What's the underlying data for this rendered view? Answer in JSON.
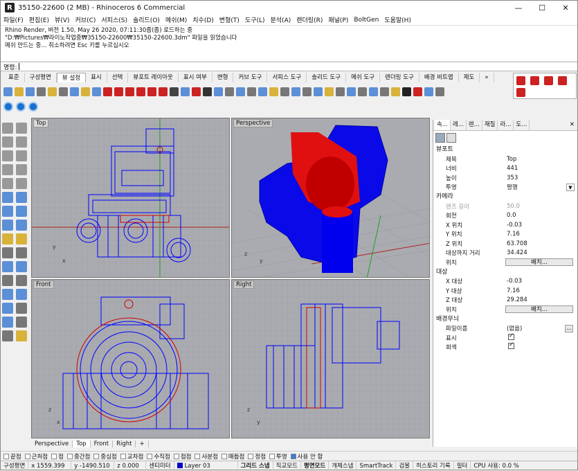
{
  "window": {
    "title": "35150-22600 (2 MB) - Rhinoceros 6 Commercial",
    "minimize": "—",
    "maximize": "☐",
    "close": "✕"
  },
  "menu": [
    "파일(F)",
    "편집(E)",
    "뷰(V)",
    "커브(C)",
    "서피스(S)",
    "솔리드(O)",
    "메쉬(M)",
    "치수(D)",
    "변형(T)",
    "도구(L)",
    "분석(A)",
    "렌더링(R)",
    "패널(P)",
    "BoltGen",
    "도움말(H)"
  ],
  "history": [
    "Rhino Render, 버전 1.50, May 26 2020, 07:11:30좀(좀) 로드하는 중",
    "\"D:₩Pictures₩라이노작업중₩35150-22600₩35150-22600.3dm\" 파일을 읽었습니다",
    "메쉬 만드는 중... 취소하려면 Esc 키를 누르십시오"
  ],
  "command": {
    "label": "명령:"
  },
  "tabs": [
    "표준",
    "구성평면",
    "뷰 설정",
    "표시",
    "선택",
    "뷰포트 레이아웃",
    "표시 여부",
    "변형",
    "커브 도구",
    "서피스 도구",
    "솔리드 도구",
    "메쉬 도구",
    "렌더링 도구",
    "배경 비트맵",
    "제도",
    "»"
  ],
  "active_tab": "뷰 설정",
  "viewports": {
    "top": "Top",
    "perspective": "Perspective",
    "front": "Front",
    "right": "Right"
  },
  "viewport_tabs": [
    "Perspective",
    "Top",
    "Front",
    "Right",
    "+"
  ],
  "panel": {
    "tabs": [
      "속...",
      "레...",
      "렌...",
      "재질",
      "라...",
      "도..."
    ],
    "section_viewport": "뷰포트",
    "title_k": "제목",
    "title_v": "Top",
    "width_k": "너비",
    "width_v": "441",
    "height_k": "높이",
    "height_v": "353",
    "proj_k": "투영",
    "proj_v": "평행",
    "section_camera": "카메라",
    "lens_k": "렌즈 길이",
    "lens_v": "50.0",
    "rot_k": "회전",
    "rot_v": "0.0",
    "x_k": "X 위치",
    "x_v": "-0.03",
    "y_k": "Y 위치",
    "y_v": "7.16",
    "z_k": "Z 위치",
    "z_v": "63.708",
    "dist_k": "대상까지 거리",
    "dist_v": "34.424",
    "pos_k": "위치",
    "place_btn": "배치...",
    "section_target": "대상",
    "tx_k": "X 대상",
    "tx_v": "-0.03",
    "ty_k": "Y 대상",
    "ty_v": "7.16",
    "tz_k": "Z 대상",
    "tz_v": "29.284",
    "tpos_k": "위치",
    "tplace_btn": "배치...",
    "section_wallpaper": "배경무늬",
    "file_k": "파일이름",
    "file_v": "(없음)",
    "file_btn": "...",
    "show_k": "표시",
    "gray_k": "회색"
  },
  "osnaps": [
    {
      "label": "끝점",
      "on": false
    },
    {
      "label": "근처점",
      "on": false
    },
    {
      "label": "점",
      "on": false
    },
    {
      "label": "중간점",
      "on": false
    },
    {
      "label": "중심점",
      "on": false
    },
    {
      "label": "교차점",
      "on": false
    },
    {
      "label": "수직점",
      "on": false
    },
    {
      "label": "접점",
      "on": false
    },
    {
      "label": "사분점",
      "on": false
    },
    {
      "label": "매듭점",
      "on": false
    },
    {
      "label": "정점",
      "on": false
    },
    {
      "label": "투영",
      "on": false
    },
    {
      "label": "사용 안 함",
      "on": true
    }
  ],
  "status": {
    "cplane": "구성평면",
    "x": "x 1559.399",
    "y": "y -1490.510",
    "z": "z 0.000",
    "units": "센티미터",
    "layer": "Layer 03",
    "grid_snap": "그리드 스냅",
    "ortho": "직교모드",
    "planar": "평면모드",
    "osnap": "개체스냅",
    "smarttrack": "SmartTrack",
    "gumball": "검볼",
    "history": "히스토리 기록",
    "filter": "필터",
    "cpu": "CPU 사용: 0.0 %"
  },
  "colors": {
    "wire": "#0000ff",
    "red": "#d00000",
    "viewport_bg": "#a9abb0",
    "grid": "#9a9ca1",
    "x_axis": "#b02020",
    "y_axis": "#20a020"
  }
}
